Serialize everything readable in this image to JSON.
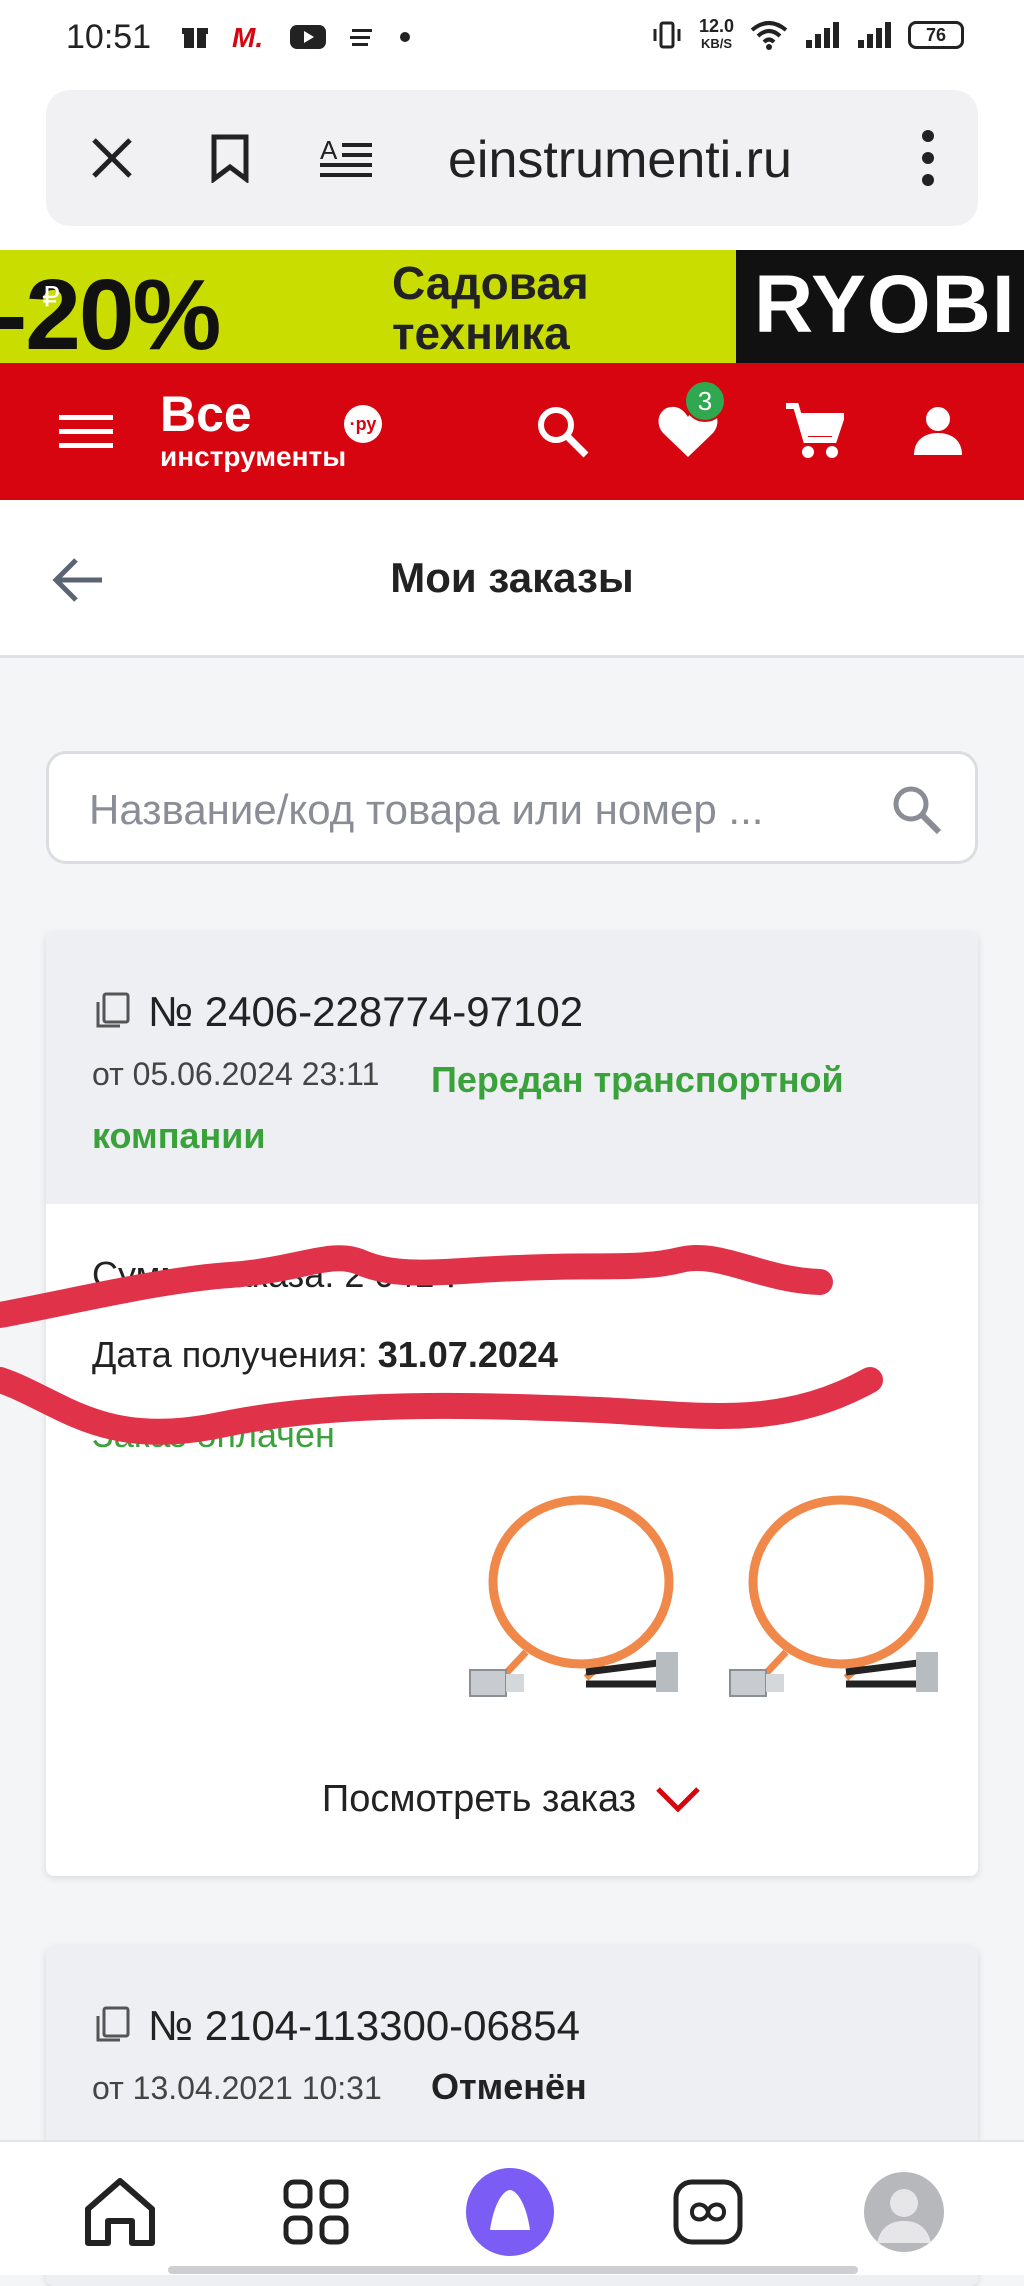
{
  "status_bar": {
    "time": "10:51",
    "net_speed": "12.0",
    "net_unit": "KB/S",
    "battery": "76"
  },
  "browser": {
    "url": "einstrumenti.ru",
    "close_icon": "close-icon",
    "bookmark_icon": "bookmark-icon",
    "reader_icon": "reader-mode-icon",
    "menu_icon": "more-vertical-icon"
  },
  "promo": {
    "discount": "-20%",
    "text_line1": "Садовая",
    "text_line2": "техника",
    "brand": "RYOBI",
    "currency_symbol": "₽",
    "bg_color": "#c9dd00"
  },
  "header": {
    "logo_line1": "Все",
    "logo_line2": "инструменты",
    "logo_badge": "·ру",
    "favorites_count": "3",
    "brand_color": "#d6050f"
  },
  "page": {
    "title": "Мои заказы"
  },
  "search": {
    "placeholder": "Название/код товара или номер ..."
  },
  "orders": [
    {
      "number": "№ 2406-228774-97102",
      "date": "от 05.06.2024 23:11",
      "status_line1": "Передан транспортной",
      "status_line2": "компании",
      "status_color": "#3aa23a",
      "sum_label": "Сумма заказа: 2 041 ₽",
      "receive_label": "Дата получения:",
      "receive_date": "31.07.2024",
      "payment_status": "Заказ оплачен",
      "view_label": "Посмотреть заказ"
    },
    {
      "number": "№ 2104-113300-06854",
      "date": "от 13.04.2021 10:31",
      "status": "Отменён"
    }
  ],
  "bottom_nav": {
    "items": [
      "home-icon",
      "grid-icon",
      "alice-icon",
      "infinity-icon",
      "profile-avatar"
    ]
  }
}
